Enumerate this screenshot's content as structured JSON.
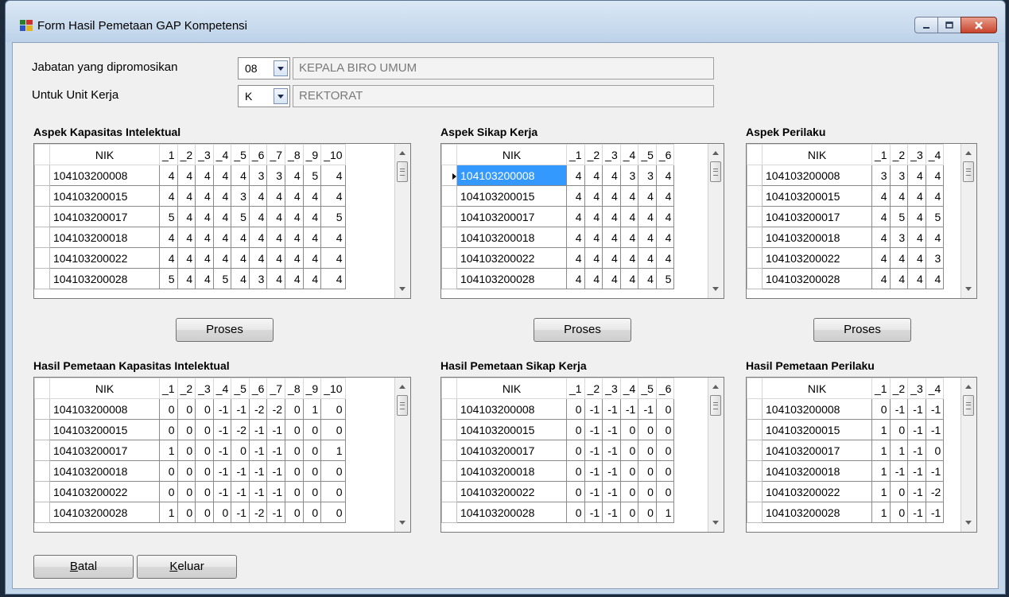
{
  "window": {
    "title": "Form Hasil Pemetaan GAP Kompetensi"
  },
  "form": {
    "jabatan_label": "Jabatan yang dipromosikan",
    "jabatan_code": "08",
    "jabatan_name": "KEPALA BIRO UMUM",
    "unit_label": "Untuk Unit Kerja",
    "unit_code": "K",
    "unit_name": "REKTORAT"
  },
  "grids": [
    {
      "title": "Aspek Kapasitas Intelektual",
      "headers": [
        "NIK",
        "_1",
        "_2",
        "_3",
        "_4",
        "_5",
        "_6",
        "_7",
        "_8",
        "_9",
        "_10"
      ],
      "rows": [
        [
          "104103200008",
          "4",
          "4",
          "4",
          "4",
          "4",
          "3",
          "3",
          "4",
          "5",
          "4"
        ],
        [
          "104103200015",
          "4",
          "4",
          "4",
          "4",
          "3",
          "4",
          "4",
          "4",
          "4",
          "4"
        ],
        [
          "104103200017",
          "5",
          "4",
          "4",
          "4",
          "5",
          "4",
          "4",
          "4",
          "4",
          "5"
        ],
        [
          "104103200018",
          "4",
          "4",
          "4",
          "4",
          "4",
          "4",
          "4",
          "4",
          "4",
          "4"
        ],
        [
          "104103200022",
          "4",
          "4",
          "4",
          "4",
          "4",
          "4",
          "4",
          "4",
          "4",
          "4"
        ],
        [
          "104103200028",
          "5",
          "4",
          "4",
          "5",
          "4",
          "3",
          "4",
          "4",
          "4",
          "4"
        ]
      ]
    },
    {
      "title": "Aspek Sikap Kerja",
      "headers": [
        "NIK",
        "_1",
        "_2",
        "_3",
        "_4",
        "_5",
        "_6"
      ],
      "rows": [
        [
          "104103200008",
          "4",
          "4",
          "4",
          "3",
          "3",
          "4"
        ],
        [
          "104103200015",
          "4",
          "4",
          "4",
          "4",
          "4",
          "4"
        ],
        [
          "104103200017",
          "4",
          "4",
          "4",
          "4",
          "4",
          "4"
        ],
        [
          "104103200018",
          "4",
          "4",
          "4",
          "4",
          "4",
          "4"
        ],
        [
          "104103200022",
          "4",
          "4",
          "4",
          "4",
          "4",
          "4"
        ],
        [
          "104103200028",
          "4",
          "4",
          "4",
          "4",
          "4",
          "5"
        ]
      ]
    },
    {
      "title": "Aspek Perilaku",
      "headers": [
        "NIK",
        "_1",
        "_2",
        "_3",
        "_4"
      ],
      "rows": [
        [
          "104103200008",
          "3",
          "3",
          "4",
          "4"
        ],
        [
          "104103200015",
          "4",
          "4",
          "4",
          "4"
        ],
        [
          "104103200017",
          "4",
          "5",
          "4",
          "5"
        ],
        [
          "104103200018",
          "4",
          "3",
          "4",
          "4"
        ],
        [
          "104103200022",
          "4",
          "4",
          "4",
          "3"
        ],
        [
          "104103200028",
          "4",
          "4",
          "4",
          "4"
        ]
      ]
    },
    {
      "title": "Hasil Pemetaan Kapasitas Intelektual",
      "headers": [
        "NIK",
        "_1",
        "_2",
        "_3",
        "_4",
        "_5",
        "_6",
        "_7",
        "_8",
        "_9",
        "_10"
      ],
      "rows": [
        [
          "104103200008",
          "0",
          "0",
          "0",
          "-1",
          "-1",
          "-2",
          "-2",
          "0",
          "1",
          "0"
        ],
        [
          "104103200015",
          "0",
          "0",
          "0",
          "-1",
          "-2",
          "-1",
          "-1",
          "0",
          "0",
          "0"
        ],
        [
          "104103200017",
          "1",
          "0",
          "0",
          "-1",
          "0",
          "-1",
          "-1",
          "0",
          "0",
          "1"
        ],
        [
          "104103200018",
          "0",
          "0",
          "0",
          "-1",
          "-1",
          "-1",
          "-1",
          "0",
          "0",
          "0"
        ],
        [
          "104103200022",
          "0",
          "0",
          "0",
          "-1",
          "-1",
          "-1",
          "-1",
          "0",
          "0",
          "0"
        ],
        [
          "104103200028",
          "1",
          "0",
          "0",
          "0",
          "-1",
          "-2",
          "-1",
          "0",
          "0",
          "0"
        ]
      ]
    },
    {
      "title": "Hasil Pemetaan Sikap Kerja",
      "headers": [
        "NIK",
        "_1",
        "_2",
        "_3",
        "_4",
        "_5",
        "_6"
      ],
      "rows": [
        [
          "104103200008",
          "0",
          "-1",
          "-1",
          "-1",
          "-1",
          "0"
        ],
        [
          "104103200015",
          "0",
          "-1",
          "-1",
          "0",
          "0",
          "0"
        ],
        [
          "104103200017",
          "0",
          "-1",
          "-1",
          "0",
          "0",
          "0"
        ],
        [
          "104103200018",
          "0",
          "-1",
          "-1",
          "0",
          "0",
          "0"
        ],
        [
          "104103200022",
          "0",
          "-1",
          "-1",
          "0",
          "0",
          "0"
        ],
        [
          "104103200028",
          "0",
          "-1",
          "-1",
          "0",
          "0",
          "1"
        ]
      ]
    },
    {
      "title": "Hasil Pemetaan Perilaku",
      "headers": [
        "NIK",
        "_1",
        "_2",
        "_3",
        "_4"
      ],
      "rows": [
        [
          "104103200008",
          "0",
          "-1",
          "-1",
          "-1"
        ],
        [
          "104103200015",
          "1",
          "0",
          "-1",
          "-1"
        ],
        [
          "104103200017",
          "1",
          "1",
          "-1",
          "0"
        ],
        [
          "104103200018",
          "1",
          "-1",
          "-1",
          "-1"
        ],
        [
          "104103200022",
          "1",
          "0",
          "-1",
          "-2"
        ],
        [
          "104103200028",
          "1",
          "0",
          "-1",
          "-1"
        ]
      ]
    }
  ],
  "buttons": {
    "proses": "Proses",
    "batal": "Batal",
    "keluar": "Keluar"
  },
  "colors": {
    "selection": "#3399ff",
    "close_button": "#c7432b"
  }
}
